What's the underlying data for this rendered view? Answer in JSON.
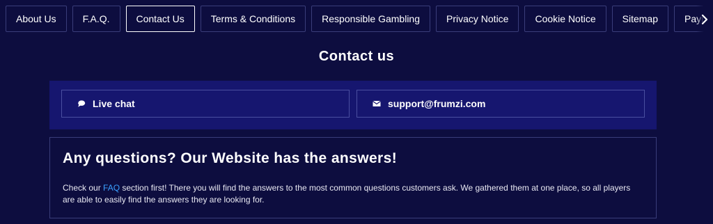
{
  "tabs": [
    {
      "label": "About Us"
    },
    {
      "label": "F.A.Q."
    },
    {
      "label": "Contact Us",
      "active": true
    },
    {
      "label": "Terms & Conditions"
    },
    {
      "label": "Responsible Gambling"
    },
    {
      "label": "Privacy Notice"
    },
    {
      "label": "Cookie Notice"
    },
    {
      "label": "Sitemap"
    },
    {
      "label": "Payment"
    }
  ],
  "page_title": "Contact us",
  "contact": {
    "live_chat_label": "Live chat",
    "email_label": "support@frumzi.com"
  },
  "faq": {
    "title": "Any questions? Our Website has the answers!",
    "text_before": "Check our ",
    "link_label": "FAQ",
    "text_after": " section first! There you will find the answers to the most common questions customers ask. We gathered them at one place, so all players are able to easily find the answers they are looking for."
  },
  "colors": {
    "background": "#0d0d3f",
    "panel": "#16166f",
    "link": "#3aa0ff"
  }
}
